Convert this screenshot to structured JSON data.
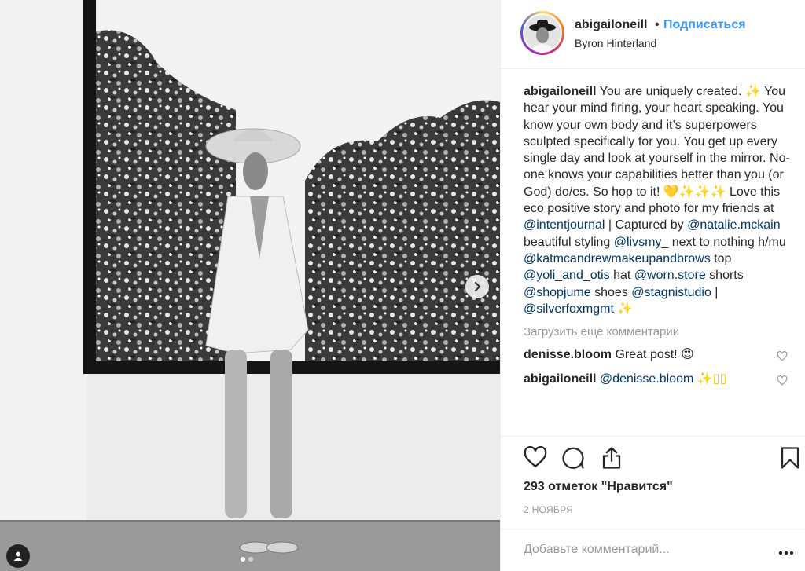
{
  "post": {
    "username": "abigailoneill",
    "separator": "•",
    "follow_label": "Подписаться",
    "location": "Byron Hinterland"
  },
  "caption": {
    "username": "abigailoneill",
    "t1": " You are uniquely created. ",
    "t2": " You hear your mind firing, your heart speaking. You know your own body and it’s superpowers sculpted specifically for you. You get up every single day and look at yourself in the mirror. No-one knows your capabilities better than you (or God) do/es. So hop to it! ",
    "heart": "💛",
    "sparkles": "✨✨✨",
    "t3": " Love this eco positive story and photo for my friends at ",
    "m1": "@intentjournal",
    "t4": " | Captured by ",
    "m2": "@natalie.mckain",
    "t5": " beautiful styling ",
    "m3": "@livsmy_",
    "t6": " next to nothing h/mu ",
    "m4": "@katmcandrewmakeupandbrows",
    "t7": " top ",
    "m5": "@yoli_and_otis",
    "t8": " hat ",
    "m6": "@worn.store",
    "t9": " shorts ",
    "m7": "@shopjume",
    "t10": " shoes ",
    "m8": "@stagnistudio",
    "t11": " | ",
    "m9": "@silverfoxmgmt",
    "sparkle": "✨"
  },
  "load_more": "Загрузить еще комментарии",
  "comments": [
    {
      "username": "denisse.bloom",
      "text": "Great post!",
      "emoji": "😍"
    },
    {
      "username": "abigailoneill",
      "mention": "@denisse.bloom",
      "emoji": "✨▯▯"
    }
  ],
  "likes": "293 отметок \"Нравится\"",
  "date": "2 ноября",
  "comment_placeholder": "Добавьте комментарий...",
  "icons": {
    "like": "heart-outline",
    "comment": "speech-bubble",
    "share": "share-arrow",
    "save": "bookmark",
    "more": "ellipsis",
    "next": "chevron-right",
    "tag": "person"
  },
  "colors": {
    "link": "#3897f0",
    "mention": "#003569",
    "muted": "#999999",
    "text": "#262626"
  },
  "carousel": {
    "slide_count": 2,
    "active_index": 0
  }
}
